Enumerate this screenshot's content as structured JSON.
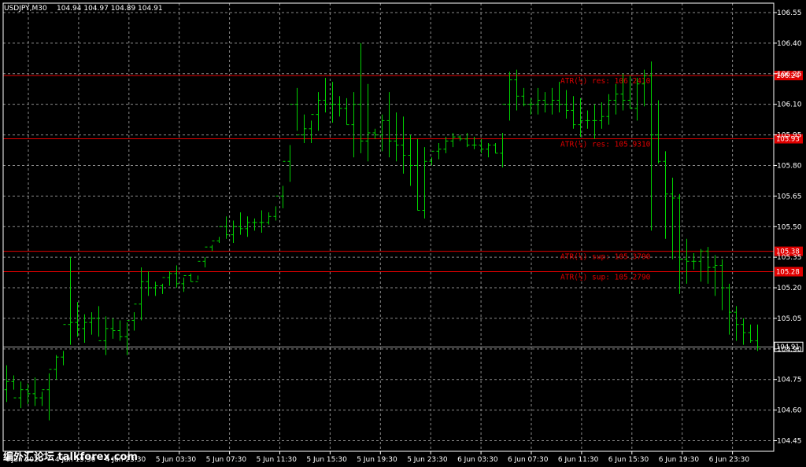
{
  "header": {
    "symbol": "USDJPY,M30",
    "ohlc": "104.94 104.97 104.89 104.91"
  },
  "watermark": {
    "text": "编外汇论坛 talkforex.com"
  },
  "colors": {
    "background": "#000000",
    "grid": "#8a8a8a",
    "bar": "#00d200",
    "level": "#e00000",
    "price_line": "#a0a0a0",
    "axis": "#ffffff"
  },
  "chart_data": {
    "type": "ohlc-bar",
    "grid": true,
    "ylim": [
      104.42,
      106.58
    ],
    "y_ticks": [
      106.55,
      106.4,
      106.25,
      106.1,
      105.95,
      105.8,
      105.65,
      105.5,
      105.35,
      105.2,
      105.05,
      104.9,
      104.75,
      104.6,
      104.45
    ],
    "y_tick_labels": [
      "106.55",
      "106.40",
      "106.25",
      "106.10",
      "105.95",
      "105.80",
      "105.65",
      "105.50",
      "105.35",
      "105.20",
      "105.05",
      "104.90",
      "104.75",
      "104.60",
      "104.45"
    ],
    "x_tick_labels": [
      "4 Jun 2020",
      "4 Jun 19:30",
      "4 Jun 23:30",
      "5 Jun 03:30",
      "5 Jun 07:30",
      "5 Jun 11:30",
      "5 Jun 15:30",
      "5 Jun 19:30",
      "5 Jun 23:30",
      "6 Jun 03:30",
      "6 Jun 07:30",
      "6 Jun 11:30",
      "6 Jun 15:30",
      "6 Jun 19:30",
      "6 Jun 23:30"
    ],
    "bars": {
      "high": [
        104.82,
        104.77,
        104.74,
        104.73,
        104.76,
        104.69,
        104.78,
        104.87,
        104.89,
        105.35,
        105.13,
        105.07,
        105.08,
        105.11,
        105.06,
        105.05,
        105.04,
        105.03,
        105.08,
        105.3,
        105.28,
        105.23,
        105.22,
        105.28,
        105.31,
        105.25,
        105.27,
        105.24,
        105.35,
        105.41,
        105.45,
        105.55,
        105.53,
        105.57,
        105.55,
        105.54,
        105.58,
        105.57,
        105.6,
        105.7,
        105.9,
        106.18,
        106.05,
        106.02,
        106.16,
        106.23,
        106.21,
        106.14,
        106.13,
        106.16,
        106.4,
        106.2,
        105.98,
        106.05,
        106.16,
        106.06,
        106.04,
        105.95,
        105.93,
        105.89,
        105.84,
        105.91,
        105.94,
        105.96,
        105.95,
        105.96,
        105.94,
        105.93,
        105.91,
        105.91,
        105.96,
        106.26,
        106.27,
        106.18,
        106.13,
        106.18,
        106.16,
        106.18,
        106.21,
        106.17,
        106.14,
        106.13,
        106.07,
        106.1,
        106.11,
        106.15,
        106.2,
        106.25,
        106.24,
        106.23,
        106.27,
        106.31,
        106.12,
        105.87,
        105.74,
        105.66,
        105.44,
        105.37,
        105.39,
        105.4,
        105.36,
        105.34,
        105.22,
        105.11,
        105.05,
        105.02,
        105.02
      ],
      "low": [
        104.64,
        104.7,
        104.61,
        104.63,
        104.62,
        104.62,
        104.55,
        104.75,
        104.82,
        104.92,
        104.96,
        104.93,
        104.97,
        104.96,
        104.87,
        104.95,
        104.94,
        104.87,
        104.99,
        105.04,
        105.16,
        105.16,
        105.17,
        105.21,
        105.2,
        105.18,
        105.23,
        105.26,
        105.3,
        105.38,
        105.42,
        105.44,
        105.42,
        105.46,
        105.45,
        105.48,
        105.47,
        105.51,
        105.53,
        105.59,
        105.72,
        105.97,
        105.91,
        105.91,
        105.97,
        106.06,
        106.01,
        106.04,
        106.0,
        105.84,
        105.86,
        105.82,
        105.93,
        105.87,
        105.84,
        105.82,
        105.76,
        105.7,
        105.58,
        105.54,
        105.8,
        105.83,
        105.86,
        105.89,
        105.92,
        105.89,
        105.88,
        105.86,
        105.84,
        105.86,
        105.79,
        106.02,
        106.07,
        106.09,
        106.05,
        106.05,
        106.06,
        106.05,
        106.06,
        106.03,
        105.98,
        105.94,
        105.98,
        105.93,
        105.98,
        106.0,
        106.05,
        106.07,
        106.08,
        106.02,
        106.09,
        105.48,
        105.81,
        105.44,
        105.34,
        105.17,
        105.22,
        105.29,
        105.23,
        105.22,
        105.16,
        105.09,
        104.97,
        104.94,
        104.92,
        104.93,
        104.89
      ],
      "open": [
        104.7,
        104.74,
        104.66,
        104.7,
        104.68,
        104.66,
        104.7,
        104.8,
        104.86,
        105.02,
        105.03,
        105.0,
        105.03,
        105.05,
        104.94,
        105.0,
        104.99,
        104.96,
        105.04,
        105.12,
        105.23,
        105.2,
        105.21,
        105.25,
        105.27,
        105.22,
        105.26,
        105.23,
        105.33,
        105.4,
        105.43,
        105.5,
        105.46,
        105.5,
        105.49,
        105.52,
        105.52,
        105.52,
        105.55,
        105.65,
        105.82,
        106.1,
        105.95,
        105.98,
        106.05,
        106.12,
        106.1,
        106.1,
        106.08,
        106.0,
        106.1,
        105.92,
        105.96,
        105.95,
        106.02,
        105.92,
        105.9,
        105.85,
        105.8,
        105.58,
        105.82,
        105.87,
        105.88,
        105.92,
        105.94,
        105.93,
        105.9,
        105.9,
        105.88,
        105.9,
        105.86,
        106.1,
        106.22,
        106.14,
        106.1,
        106.1,
        106.12,
        106.1,
        106.12,
        106.1,
        106.07,
        106.0,
        106.02,
        106.02,
        106.02,
        106.04,
        106.12,
        106.15,
        106.12,
        106.08,
        106.2,
        106.24,
        105.95,
        105.82,
        105.66,
        105.64,
        105.34,
        105.33,
        105.33,
        105.38,
        105.3,
        105.31,
        105.2,
        105.08,
        105.02,
        104.98,
        104.94
      ],
      "close": [
        104.74,
        104.66,
        104.7,
        104.68,
        104.66,
        104.7,
        104.8,
        104.86,
        105.02,
        105.03,
        105.0,
        105.03,
        105.05,
        104.94,
        105.0,
        104.99,
        104.96,
        105.04,
        105.12,
        105.23,
        105.2,
        105.21,
        105.25,
        105.27,
        105.22,
        105.26,
        105.23,
        105.33,
        105.4,
        105.43,
        105.5,
        105.46,
        105.5,
        105.49,
        105.52,
        105.52,
        105.52,
        105.55,
        105.65,
        105.82,
        106.1,
        105.95,
        105.98,
        106.05,
        106.12,
        106.1,
        106.1,
        106.08,
        106.0,
        106.1,
        105.92,
        105.96,
        105.95,
        106.02,
        105.92,
        105.9,
        105.85,
        105.8,
        105.58,
        105.82,
        105.87,
        105.88,
        105.92,
        105.94,
        105.93,
        105.9,
        105.9,
        105.88,
        105.9,
        105.86,
        106.1,
        106.22,
        106.14,
        106.1,
        106.1,
        106.12,
        106.1,
        106.12,
        106.1,
        106.07,
        106.0,
        106.02,
        106.02,
        106.02,
        106.04,
        106.12,
        106.15,
        106.12,
        106.08,
        106.2,
        106.24,
        105.95,
        105.82,
        105.66,
        105.64,
        105.34,
        105.33,
        105.33,
        105.38,
        105.3,
        105.31,
        105.2,
        105.08,
        105.02,
        104.98,
        104.94,
        104.91
      ]
    },
    "levels": [
      {
        "price": 106.241,
        "label": "ATR(½) res: 106.2410",
        "tag": "106.24"
      },
      {
        "price": 105.931,
        "label": "ATR(¼) res: 105.9310",
        "tag": "105.93"
      },
      {
        "price": 105.379,
        "label": "ATR(¼) sup: 105.3790",
        "tag": "105.38"
      },
      {
        "price": 105.279,
        "label": "ATR(½) sup: 105.2790",
        "tag": "105.28"
      }
    ],
    "current_price": {
      "price": 104.91,
      "tag": "104.91"
    }
  }
}
